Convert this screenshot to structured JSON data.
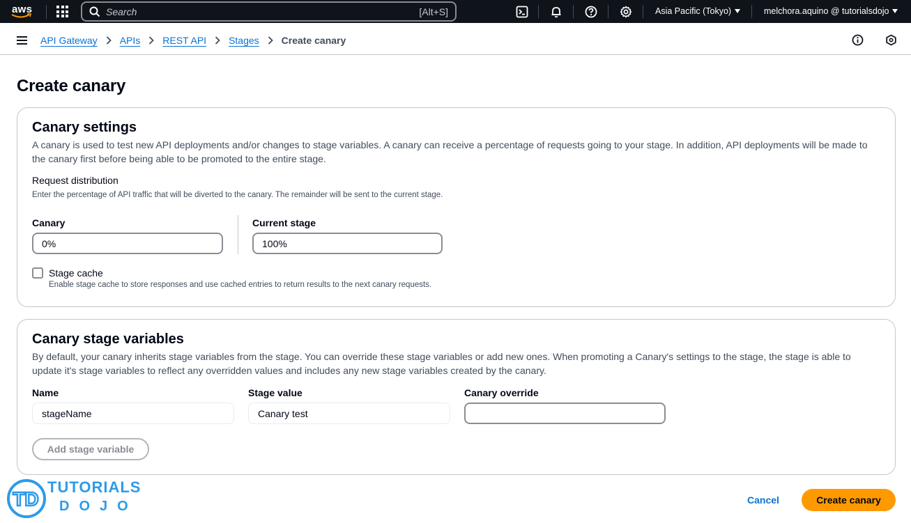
{
  "topnav": {
    "logo_text": "aws",
    "search_placeholder": "Search",
    "search_shortcut": "[Alt+S]",
    "region": "Asia Pacific (Tokyo)",
    "user": "melchora.aquino @ tutorialsdojo"
  },
  "breadcrumbs": {
    "items": [
      "API Gateway",
      "APIs",
      "REST API",
      "Stages"
    ],
    "current": "Create canary"
  },
  "page": {
    "title": "Create canary"
  },
  "canary_settings": {
    "title": "Canary settings",
    "description": "A canary is used to test new API deployments and/or changes to stage variables. A canary can receive a percentage of requests going to your stage. In addition, API deployments will be made to the canary first before being able to be promoted to the entire stage.",
    "request_distribution_label": "Request distribution",
    "request_distribution_hint": "Enter the percentage of API traffic that will be diverted to the canary. The remainder will be sent to the current stage.",
    "canary_label": "Canary",
    "canary_value": "0%",
    "current_stage_label": "Current stage",
    "current_stage_value": "100%",
    "stage_cache_label": "Stage cache",
    "stage_cache_hint": "Enable stage cache to store responses and use cached entries to return results to the next canary requests."
  },
  "stage_variables": {
    "title": "Canary stage variables",
    "description": "By default, your canary inherits stage variables from the stage. You can override these stage variables or add new ones. When promoting a Canary's settings to the stage, the stage is able to update it's stage variables to reflect any overridden values and includes any new stage variables created by the canary.",
    "col_name": "Name",
    "col_stage_value": "Stage value",
    "col_canary_override": "Canary override",
    "row_name": "stageName",
    "row_stage_value": "Canary test",
    "row_canary_override": "",
    "add_button": "Add stage variable"
  },
  "footer": {
    "cancel": "Cancel",
    "create": "Create canary"
  },
  "watermark": {
    "logo_letters": "TD",
    "line1": "TUTORIALS",
    "line2": "DOJO"
  }
}
